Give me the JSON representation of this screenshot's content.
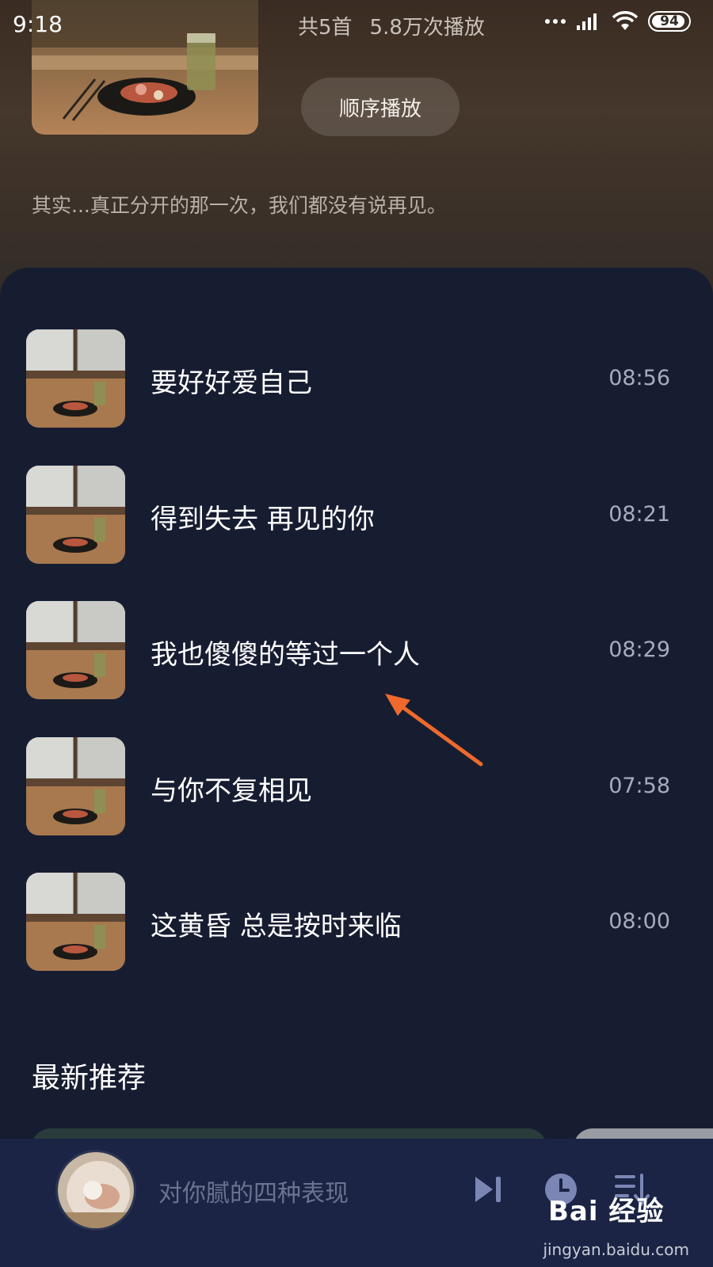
{
  "status_bar": {
    "time": "9:18",
    "battery_level": "94"
  },
  "playlist": {
    "song_count": "共5首",
    "play_count": "5.8万次播放",
    "play_order_label": "顺序播放",
    "description": "其实...真正分开的那一次，我们都没有说再见。"
  },
  "songs": [
    {
      "title": "要好好爱自己",
      "duration": "08:56"
    },
    {
      "title": "得到失去 再见的你",
      "duration": "08:21"
    },
    {
      "title": "我也傻傻的等过一个人",
      "duration": "08:29"
    },
    {
      "title": "与你不复相见",
      "duration": "07:58"
    },
    {
      "title": "这黄昏 总是按时来临",
      "duration": "08:00"
    }
  ],
  "recommend_section": {
    "title": "最新推荐"
  },
  "player": {
    "now_playing": "对你腻的四种表现"
  },
  "watermark": {
    "logo": "Bai 经验",
    "url": "jingyan.baidu.com"
  },
  "colors": {
    "accent": "#7b86b5",
    "annotation_arrow": "#ee6a2c",
    "list_background": "#171d31",
    "player_background": "#1b2444"
  }
}
